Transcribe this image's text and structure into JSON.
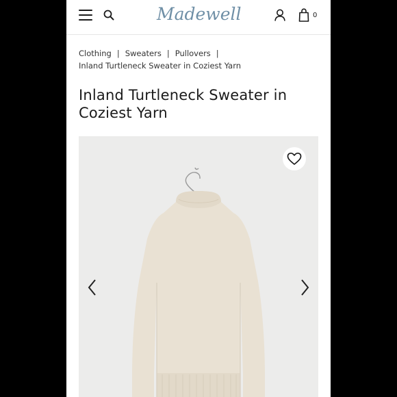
{
  "header": {
    "logo_text": "Madewell",
    "bag_count": "0",
    "icons": [
      "menu-icon",
      "search-icon",
      "account-icon",
      "bag-icon"
    ]
  },
  "breadcrumb": {
    "items": [
      "Clothing",
      "Sweaters",
      "Pullovers"
    ],
    "separator": "|",
    "current": "Inland Turtleneck Sweater in Coziest Yarn"
  },
  "product": {
    "title": "Inland Turtleneck Sweater in Coziest Yarn",
    "gallery_icons": [
      "heart-icon",
      "chevron-left-icon",
      "chevron-right-icon"
    ]
  },
  "colors": {
    "logo": "#6f8fa6",
    "sweater": "#e9e1d3",
    "gallery_bg": "#ececeb"
  }
}
